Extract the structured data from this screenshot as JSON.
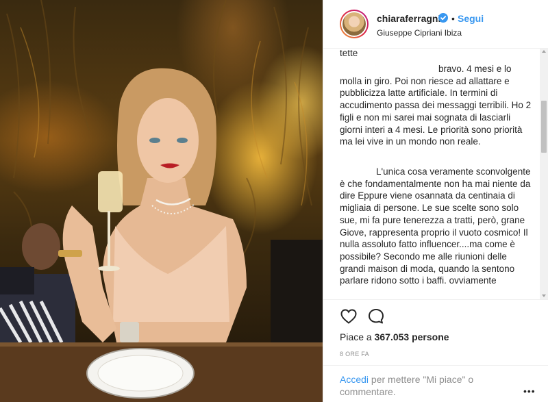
{
  "post": {
    "username": "chiaraferragni",
    "verified_icon": "verified-badge-icon",
    "separator": "•",
    "follow_label": "Segui",
    "location": "Giuseppe Cipriani Ibiza"
  },
  "comments": {
    "partial_top": "tette",
    "comment1": "bravo. 4 mesi e lo molla in giro. Poi non riesce ad allattare e pubblicizza latte artificiale. In termini di accudimento passa dei messaggi terribili. Ho 2 figli e non mi sarei mai sognata di lasciarli giorni interi a 4 mesi. Le priorità sono priorità ma lei vive in un mondo non reale.",
    "comment2": "L'unica cosa veramente sconvolgente è che fondamentalmente non ha mai niente da dire Eppure viene osannata da centinaia di migliaia di persone. Le sue scelte sono solo sue, mi fa pure tenerezza a tratti, però, grane Giove, rappresenta proprio il vuoto cosmico! Il nulla assoluto fatto influencer....ma come è possibile? Secondo me alle riunioni delle grandi maison di moda, quando la sentono parlare ridono sotto i baffi. ovviamente"
  },
  "actions": {
    "like_icon": "heart-icon",
    "comment_icon": "comment-bubble-icon",
    "likes_prefix": "Piace a",
    "likes_count": "367.053 persone",
    "timestamp": "8 ORE FA",
    "login_link": "Accedi",
    "login_text": "per mettere \"Mi piace\" o commentare.",
    "more_label": "•••"
  },
  "colors": {
    "accent": "#3897f0",
    "text": "#262626",
    "muted": "#8e8e8e"
  }
}
